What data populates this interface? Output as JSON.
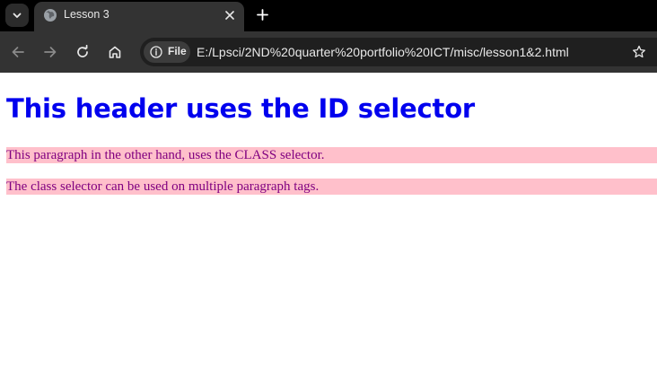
{
  "browser": {
    "tab": {
      "title": "Lesson 3",
      "favicon": "globe-icon"
    },
    "address_bar": {
      "chip_label": "File",
      "url": "E:/Lpsci/2ND%20quarter%20portfolio%20ICT/misc/lesson1&2.html"
    },
    "icons": [
      "tab-search-icon",
      "close-icon",
      "plus-icon",
      "back-arrow-icon",
      "forward-arrow-icon",
      "reload-icon",
      "home-icon",
      "info-icon",
      "star-icon"
    ],
    "colors": {
      "tabbar": "#000000",
      "toolbar": "#333333",
      "omnibox": "#1f1f1f"
    }
  },
  "page": {
    "heading": "This header uses the ID selector",
    "paragraphs": [
      "This paragraph in the other hand, uses the CLASS selector.",
      "The class selector can be used on multiple paragraph tags."
    ],
    "colors": {
      "heading": "#0000ee",
      "paragraph_text": "#800080",
      "paragraph_background": "#ffc0cb"
    }
  }
}
